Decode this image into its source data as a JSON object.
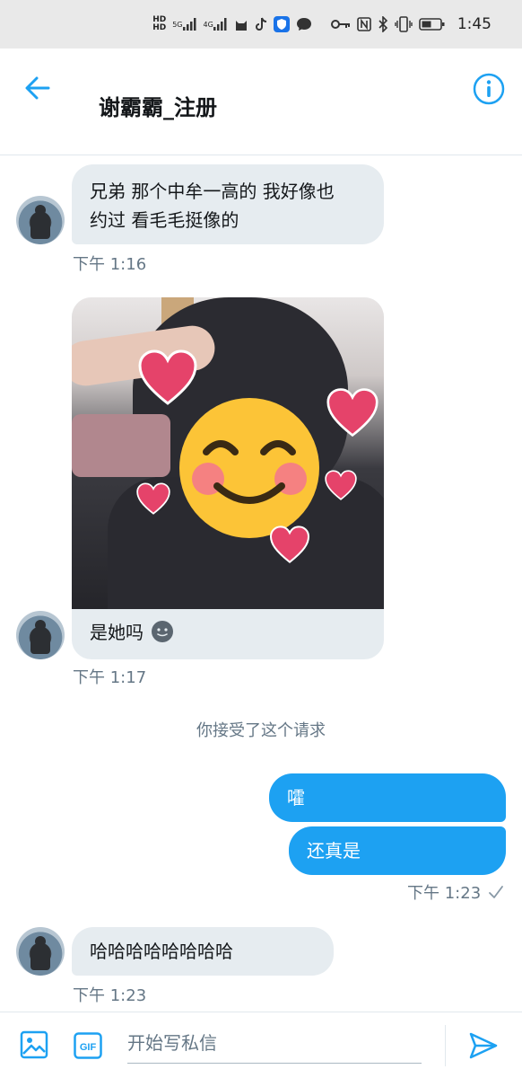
{
  "status_bar": {
    "network_left": "HD",
    "network_left2": "HD",
    "signal1_label": "5G",
    "signal2_label": "4G",
    "time": "1:45"
  },
  "header": {
    "title": "谢霸霸_注册"
  },
  "messages": [
    {
      "text_line1": "兄弟 那个中牟一高的 我好像也",
      "text_line2": "约过 看毛毛挺像的",
      "time": "下午 1:16"
    },
    {
      "caption": "是她吗",
      "time": "下午 1:17"
    },
    {
      "system": "你接受了这个请求"
    },
    {
      "text": "嚯"
    },
    {
      "text": "还真是",
      "time": "下午 1:23"
    },
    {
      "text": "哈哈哈哈哈哈哈哈",
      "time": "下午 1:23"
    }
  ],
  "composer": {
    "placeholder": "开始写私信",
    "gif_label": "GIF"
  },
  "colors": {
    "accent": "#1da1f2",
    "incoming_bubble": "#e6ecf0",
    "meta_text": "#657786"
  },
  "icons": [
    "back-arrow-icon",
    "info-icon",
    "image-icon",
    "gif-icon",
    "send-icon",
    "check-icon",
    "emoji-icon"
  ]
}
